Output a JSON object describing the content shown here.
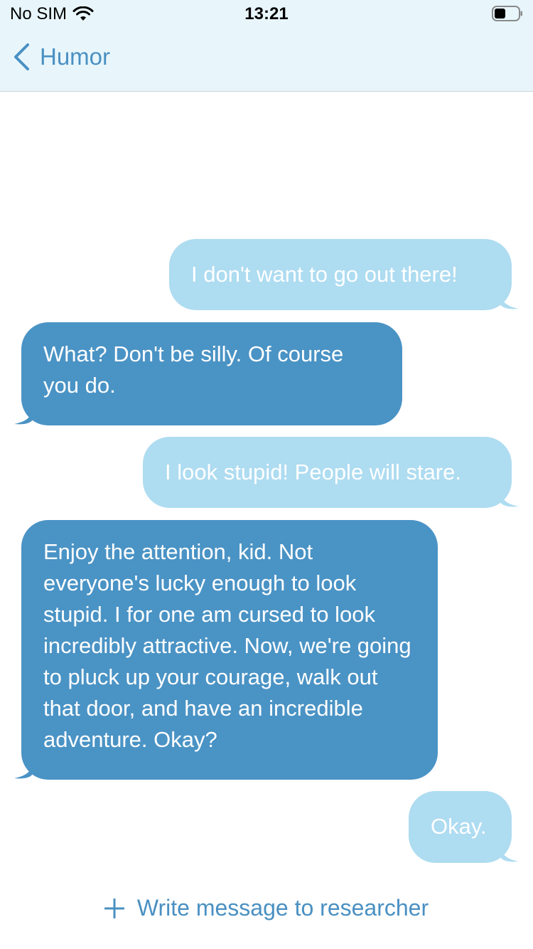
{
  "status_bar": {
    "carrier": "No SIM",
    "time": "13:21"
  },
  "nav": {
    "back_label": "Humor"
  },
  "messages": [
    {
      "side": "outgoing",
      "text": "I don't want to go out there!"
    },
    {
      "side": "incoming",
      "text": "What? Don't be silly. Of course you do."
    },
    {
      "side": "outgoing",
      "text": "I look stupid! People will stare."
    },
    {
      "side": "incoming",
      "text": "Enjoy the attention, kid. Not everyone's lucky enough to look stupid. I for one am cursed to look incredibly attractive. Now, we're going to pluck up your courage, walk out that door, and have an incredible adventure. Okay?"
    },
    {
      "side": "outgoing",
      "text": "Okay."
    }
  ],
  "compose": {
    "label": "Write message to researcher"
  },
  "colors": {
    "accent": "#4a90c2",
    "outgoing_bubble": "#aedcf1",
    "incoming_bubble": "#4a93c5",
    "header_bg": "#e8f6fc"
  }
}
